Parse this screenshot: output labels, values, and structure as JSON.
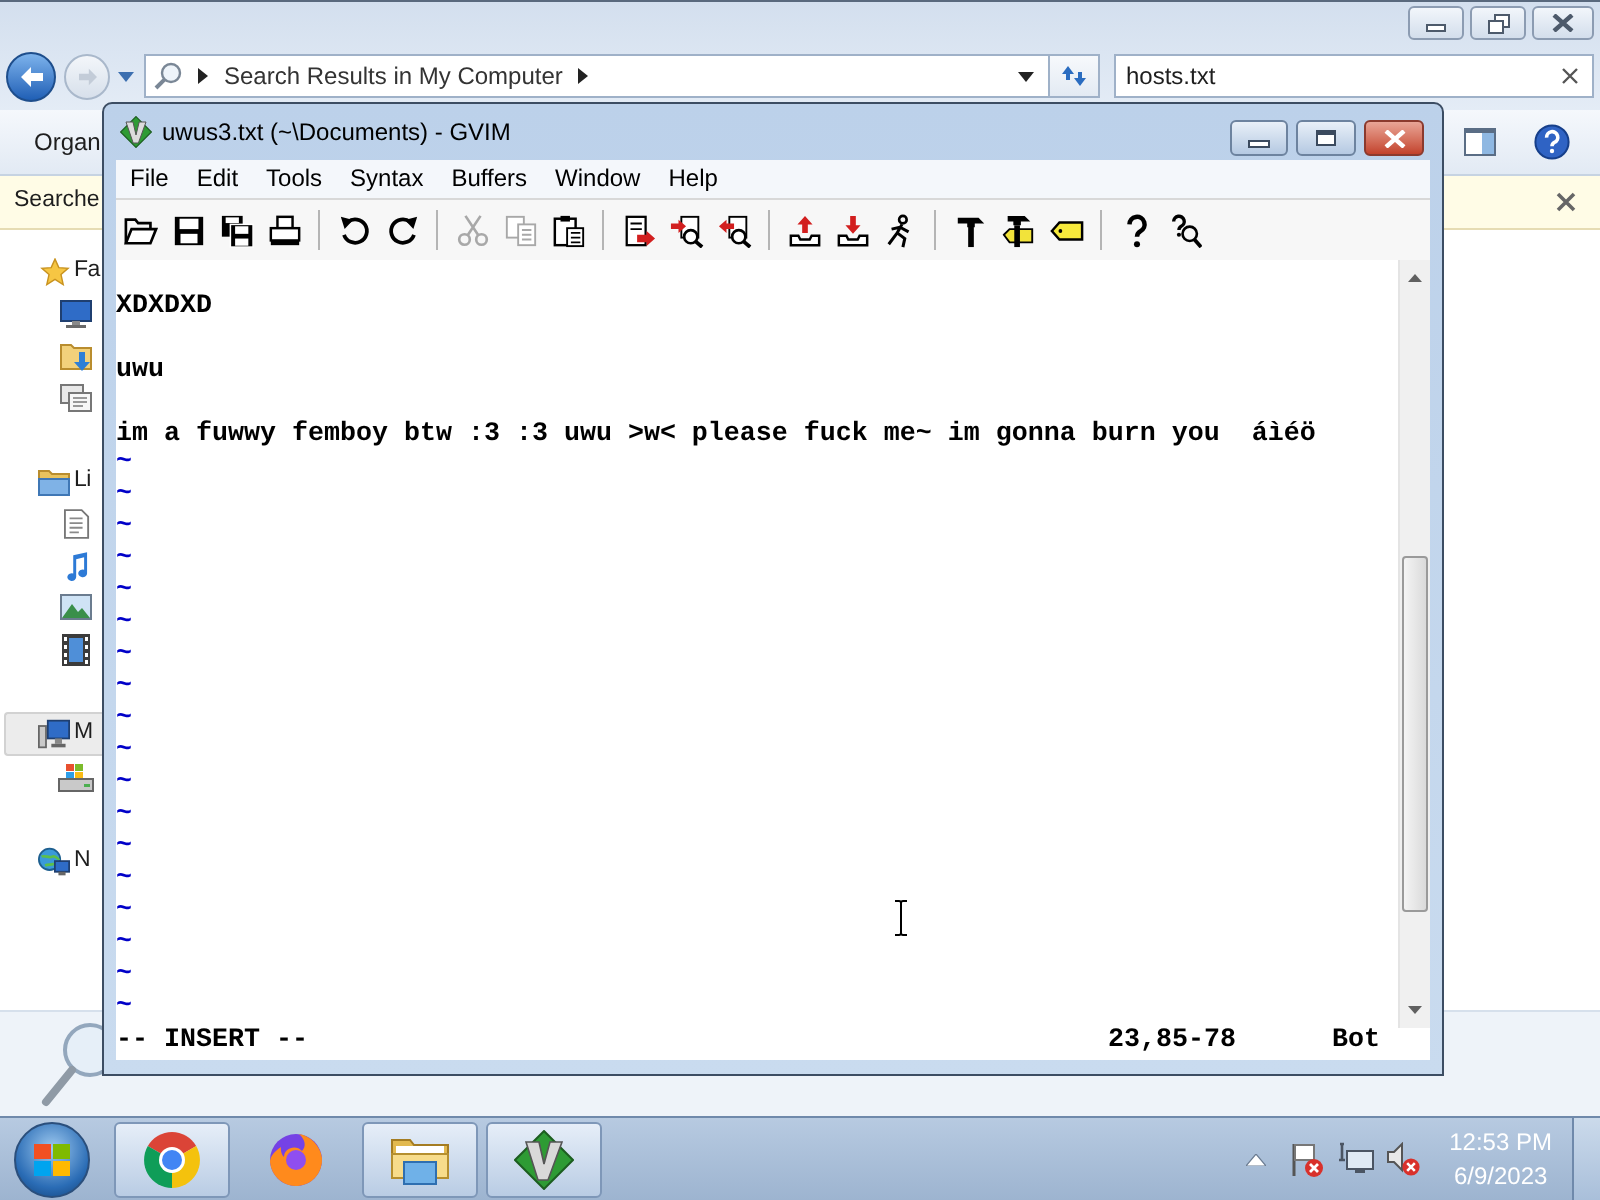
{
  "explorer": {
    "address": {
      "breadcrumb": "Search Results in My Computer"
    },
    "search": {
      "value": "hosts.txt"
    },
    "command_bar": {
      "organize": "Organ"
    },
    "info_bar": {
      "text": "Searche"
    },
    "nav_pane": [
      {
        "label": "Fa",
        "selected": false,
        "children": [
          {
            "selected": false
          },
          {
            "selected": false
          },
          {
            "selected": false
          }
        ]
      },
      {
        "label": "Li",
        "selected": false,
        "children": [
          {
            "selected": false
          },
          {
            "selected": false
          },
          {
            "selected": false
          },
          {
            "selected": false
          }
        ]
      },
      {
        "label": "M",
        "selected": true,
        "children": [
          {
            "selected": false
          }
        ]
      },
      {
        "label": "N",
        "selected": false
      }
    ]
  },
  "gvim": {
    "title": "uwus3.txt (~\\Documents) - GVIM",
    "menu": [
      "File",
      "Edit",
      "Tools",
      "Syntax",
      "Buffers",
      "Window",
      "Help"
    ],
    "toolbar": [
      {
        "buttons": [
          {
            "disabled": false
          },
          {
            "disabled": false
          },
          {
            "disabled": false
          },
          {
            "disabled": false
          }
        ]
      },
      {
        "buttons": [
          {
            "disabled": false
          },
          {
            "disabled": false
          }
        ]
      },
      {
        "buttons": [
          {
            "disabled": true
          },
          {
            "disabled": true
          },
          {
            "disabled": false
          }
        ]
      },
      {
        "buttons": [
          {
            "disabled": false
          },
          {
            "disabled": false
          },
          {
            "disabled": false
          }
        ]
      },
      {
        "buttons": [
          {
            "disabled": false
          },
          {
            "disabled": false
          },
          {
            "disabled": false
          }
        ]
      },
      {
        "buttons": [
          {
            "disabled": false
          },
          {
            "disabled": false
          },
          {
            "disabled": false
          }
        ]
      },
      {
        "buttons": [
          {
            "disabled": false
          },
          {
            "disabled": false
          }
        ]
      }
    ],
    "buffer": [
      "XDXDXD",
      "uwu",
      "im a fuwwy femboy btw :3 :3 uwu >w< please fuck me~ im gonna burn you  áìéö"
    ],
    "filler_lines": [
      "~",
      "~",
      "~",
      "~",
      "~",
      "~",
      "~",
      "~",
      "~",
      "~",
      "~",
      "~",
      "~",
      "~",
      "~",
      "~",
      "~",
      "~"
    ],
    "status_line": {
      "mode": "-- INSERT --",
      "ruler": "23,85-78",
      "position": "Bot"
    }
  },
  "taskbar": {
    "buttons": [
      {
        "running": true
      },
      {
        "running": false
      },
      {
        "running": true
      },
      {
        "running": true
      }
    ],
    "clock": {
      "time": "12:53 PM",
      "date": "6/9/2023"
    }
  }
}
